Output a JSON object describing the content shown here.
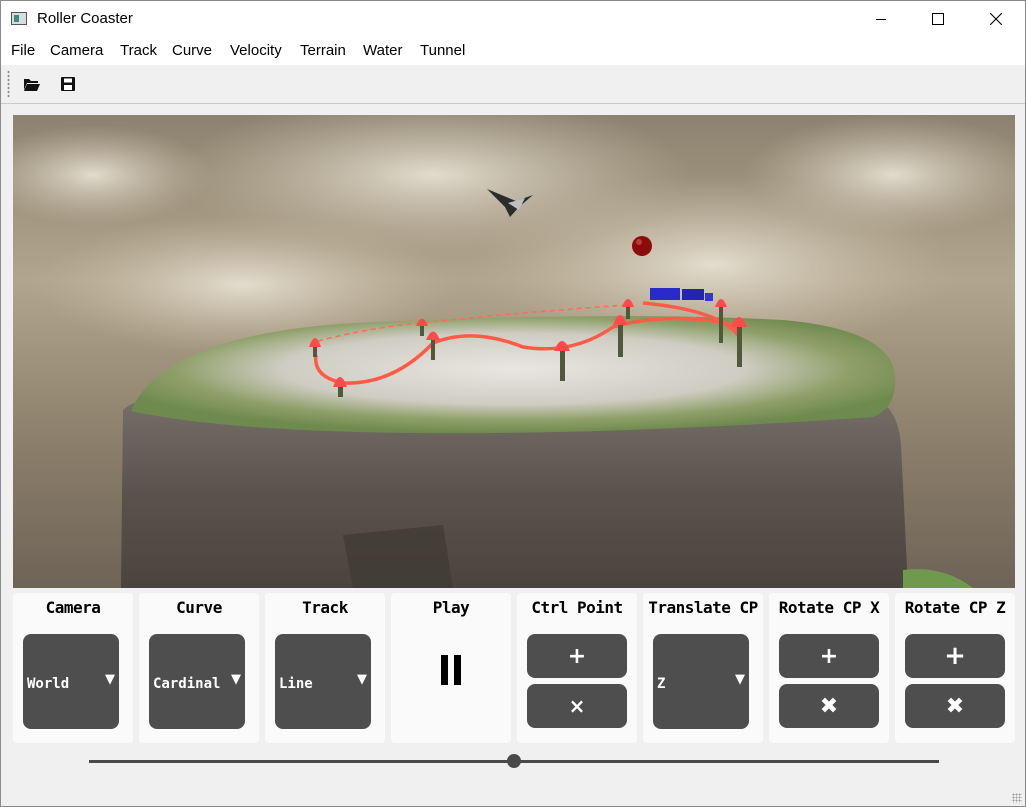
{
  "window": {
    "title": "Roller Coaster",
    "controls": [
      "minimize",
      "maximize",
      "close"
    ]
  },
  "menu": [
    "File",
    "Camera",
    "Track",
    "Curve",
    "Velocity",
    "Terrain",
    "Water",
    "Tunnel"
  ],
  "toolbar": {
    "open_icon": "folder-open-icon",
    "save_icon": "floppy-disk-icon"
  },
  "viewport": {
    "scene": "3d-roller-coaster-scene",
    "colors": {
      "track": "#ff5a47",
      "control_point": "#ff4a4a",
      "train": "#2a2ac8",
      "ball": "#8a0c0c"
    }
  },
  "panels": {
    "camera": {
      "title": "Camera",
      "value": "World"
    },
    "curve": {
      "title": "Curve",
      "value": "Cardinal"
    },
    "track": {
      "title": "Track",
      "value": "Line"
    },
    "play": {
      "title": "Play",
      "icon": "pause-icon"
    },
    "ctrl_point": {
      "title": "Ctrl Point",
      "plus": "+",
      "minus": "×"
    },
    "translate_cp": {
      "title": "Translate CP",
      "value": "Z"
    },
    "rotate_cp_x": {
      "title": "Rotate CP X",
      "plus": "+",
      "minus": "✖"
    },
    "rotate_cp_z": {
      "title": "Rotate CP Z",
      "plus": "+",
      "minus": "✖"
    }
  },
  "slider": {
    "value": 0.5
  }
}
